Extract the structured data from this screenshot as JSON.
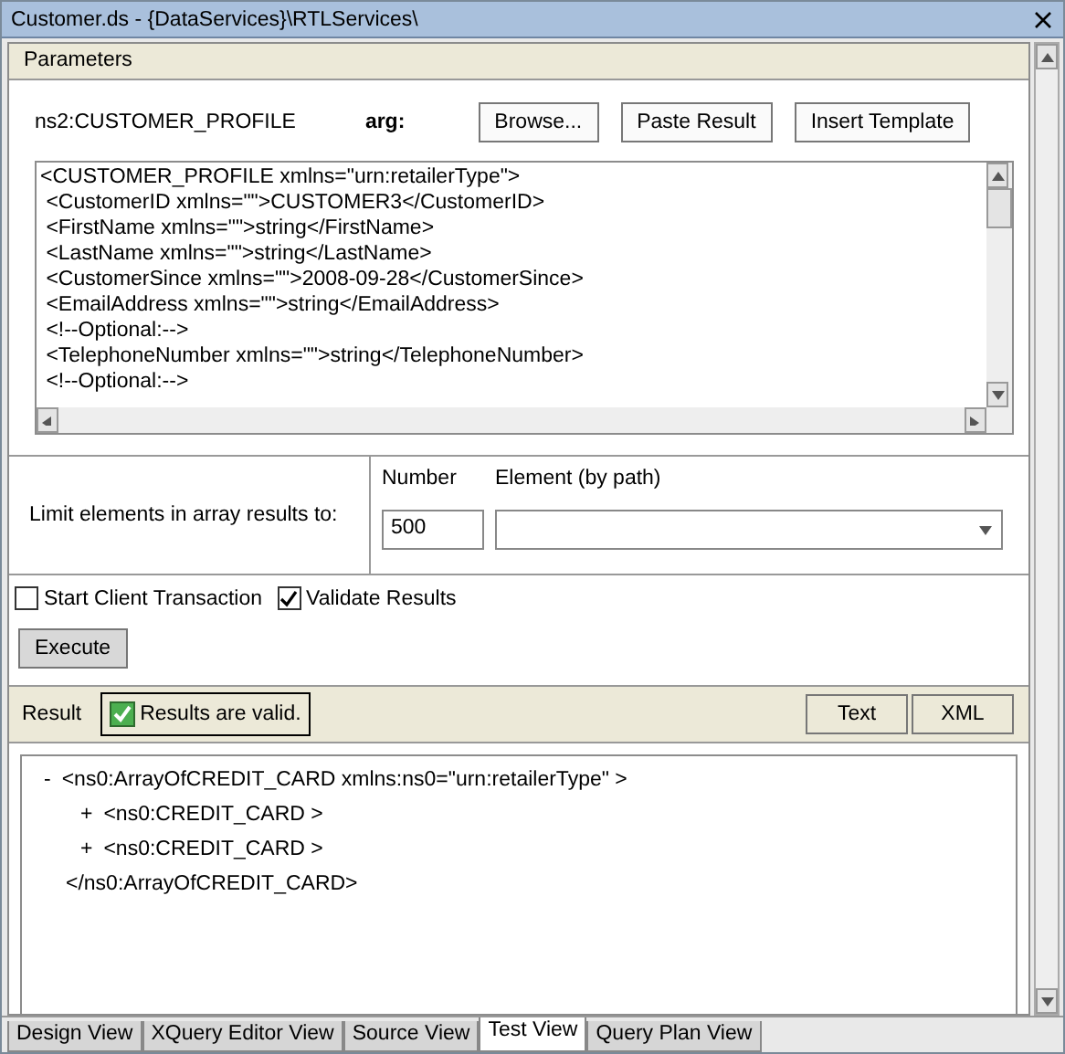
{
  "window": {
    "title": "Customer.ds - {DataServices}\\RTLServices\\"
  },
  "parameters": {
    "header": "Parameters",
    "param_name": "ns2:CUSTOMER_PROFILE",
    "arg_label": "arg:",
    "buttons": [
      "Browse...",
      "Paste Result",
      "Insert Template"
    ],
    "xml_lines": [
      "<CUSTOMER_PROFILE xmlns=\"urn:retailerType\">",
      " <CustomerID xmlns=\"\">CUSTOMER3</CustomerID>",
      " <FirstName xmlns=\"\">string</FirstName>",
      " <LastName xmlns=\"\">string</LastName>",
      " <CustomerSince xmlns=\"\">2008-09-28</CustomerSince>",
      " <EmailAddress xmlns=\"\">string</EmailAddress>",
      " <!--Optional:-->",
      " <TelephoneNumber xmlns=\"\">string</TelephoneNumber>",
      " <!--Optional:-->"
    ]
  },
  "limit": {
    "label": "Limit elements in array results to:",
    "number_label": "Number",
    "number_value": "500",
    "element_label": "Element (by path)"
  },
  "options": [
    {
      "label": "Start Client Transaction",
      "checked": false
    },
    {
      "label": "Validate Results",
      "checked": true
    }
  ],
  "execute_button": "Execute",
  "result": {
    "label": "Result",
    "status": "Results are valid.",
    "valid": true,
    "views": [
      {
        "label": "Text",
        "selected": false
      },
      {
        "label": "XML",
        "selected": false
      }
    ],
    "tree": [
      {
        "toggle": "-",
        "text": "<ns0:ArrayOfCREDIT_CARD xmlns:ns0=\"urn:retailerType\" >",
        "closing": "</ns0:ArrayOfCREDIT_CARD>",
        "children": [
          {
            "toggle": "+",
            "text": "<ns0:CREDIT_CARD >"
          },
          {
            "toggle": "+",
            "text": "<ns0:CREDIT_CARD >"
          }
        ]
      }
    ]
  },
  "tabs": [
    {
      "label": "Design View",
      "selected": false
    },
    {
      "label": "XQuery Editor View",
      "selected": false
    },
    {
      "label": "Source View",
      "selected": false
    },
    {
      "label": "Test View",
      "selected": true
    },
    {
      "label": "Query Plan View",
      "selected": false
    }
  ]
}
